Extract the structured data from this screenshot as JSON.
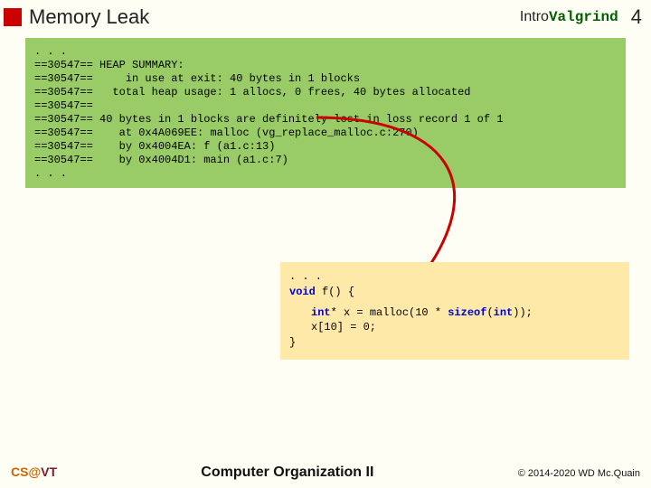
{
  "header": {
    "title": "Memory Leak",
    "intro": "Intro ",
    "valgrind": "Valgrind",
    "page": "4"
  },
  "valgrind_output": ". . .\n==30547== HEAP SUMMARY:\n==30547==     in use at exit: 40 bytes in 1 blocks\n==30547==   total heap usage: 1 allocs, 0 frees, 40 bytes allocated\n==30547==\n==30547== 40 bytes in 1 blocks are definitely lost in loss record 1 of 1\n==30547==    at 0x4A069EE: malloc (vg_replace_malloc.c:270)\n==30547==    by 0x4004EA: f (a1.c:13)\n==30547==    by 0x4004D1: main (a1.c:7)\n. . .",
  "code": {
    "pre": ". . .",
    "sig_kw1": "void",
    "sig_rest": " f() {",
    "line_kw1": "int",
    "line_rest1": "* x = malloc(10 * ",
    "line_kw2": "sizeof",
    "line_rest2": "(",
    "line_kw3": "int",
    "line_rest3": "));",
    "line2": "x[10] = 0;",
    "close": "}"
  },
  "footer": {
    "cs": "CS",
    "at": "@",
    "vt": "VT",
    "center": "Computer Organization II",
    "right": "© 2014-2020 WD Mc.Quain"
  }
}
